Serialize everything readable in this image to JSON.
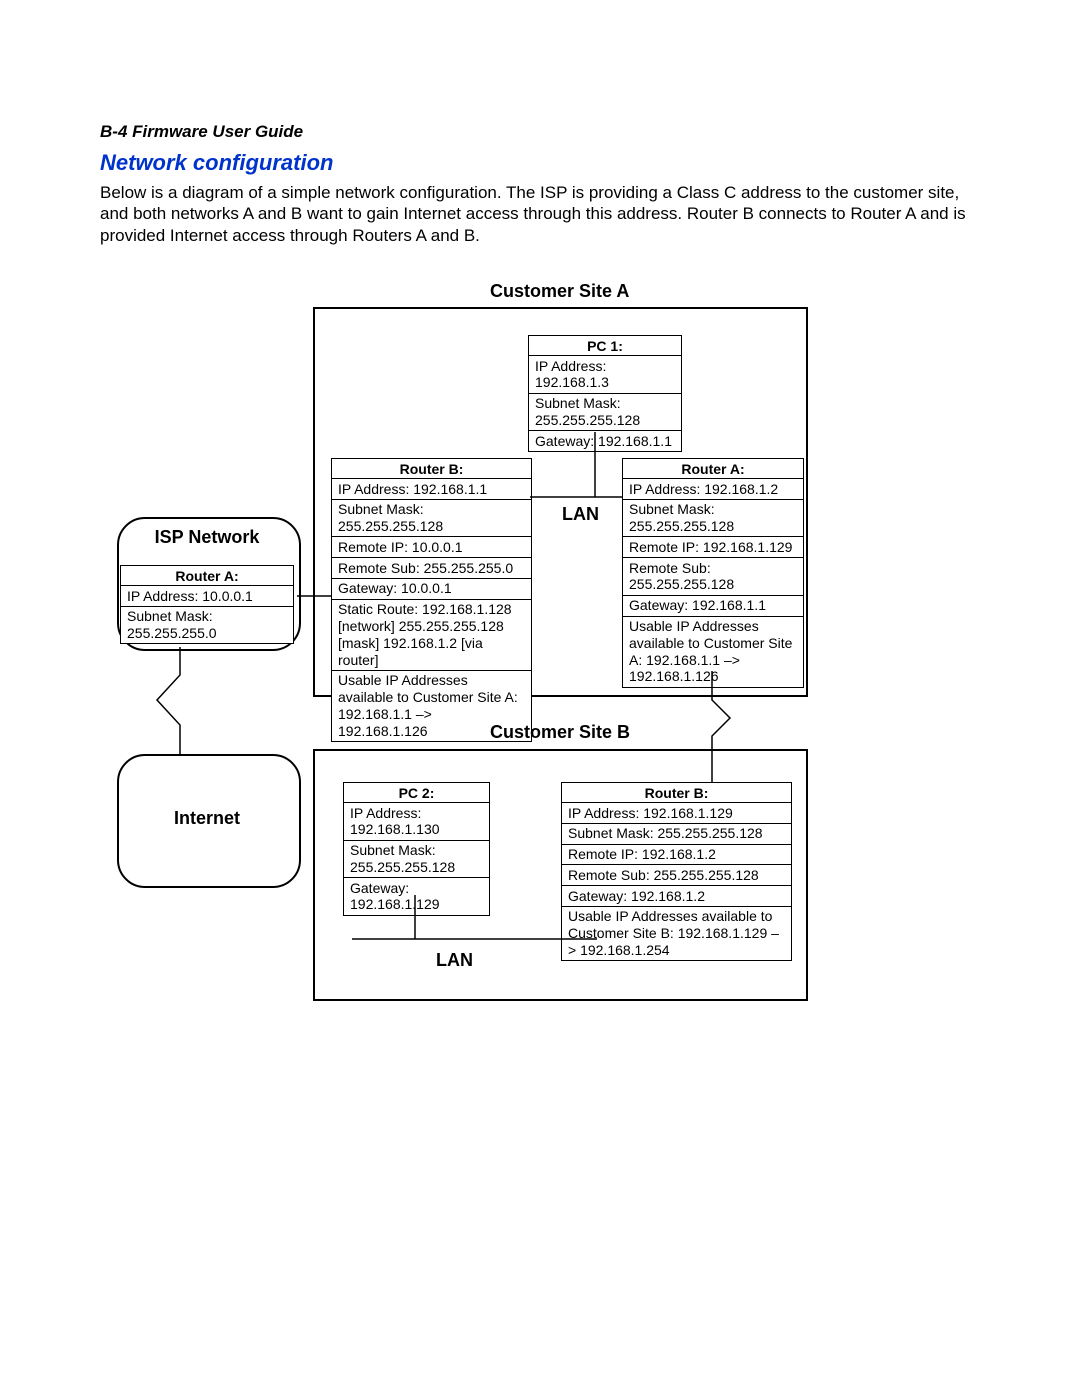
{
  "header": "B-4  Firmware User Guide",
  "title": "Network configuration",
  "body": "Below is a diagram of a simple network configuration. The ISP is providing a Class C address to the customer site, and both networks A and B want to gain Internet access through this address. Router B connects to Router A and is provided Internet access through Routers A and B.",
  "siteA": {
    "title": "Customer Site A",
    "lan": "LAN"
  },
  "siteB": {
    "title": "Customer Site B",
    "lan": "LAN"
  },
  "isp": {
    "title": "ISP Network",
    "routerA": {
      "label": "Router A:",
      "ip": "IP Address: 10.0.0.1",
      "mask": "Subnet Mask: 255.255.255.0"
    }
  },
  "internet": {
    "title": "Internet"
  },
  "pc1": {
    "label": "PC 1:",
    "ip": "IP Address: 192.168.1.3",
    "mask": "Subnet Mask: 255.255.255.128",
    "gw": "Gateway: 192.168.1.1"
  },
  "routerB_A": {
    "label": "Router B:",
    "ip": "IP Address: 192.168.1.1",
    "mask": "Subnet Mask: 255.255.255.128",
    "rip": "Remote IP: 10.0.0.1",
    "rsub": "Remote Sub: 255.255.255.0",
    "gw": "Gateway: 10.0.0.1",
    "static": "Static Route: 192.168.1.128 [network] 255.255.255.128 [mask] 192.168.1.2 [via router]",
    "usable": "Usable IP Addresses available to Customer Site A: 192.168.1.1 –> 192.168.1.126"
  },
  "routerA_A": {
    "label": "Router A:",
    "ip": "IP Address: 192.168.1.2",
    "mask": "Subnet Mask: 255.255.255.128",
    "rip": "Remote IP: 192.168.1.129",
    "rsub": "Remote Sub: 255.255.255.128",
    "gw": "Gateway: 192.168.1.1",
    "usable": "Usable IP Addresses available to Customer Site A: 192.168.1.1 –> 192.168.1.126"
  },
  "pc2": {
    "label": "PC 2:",
    "ip": "IP Address: 192.168.1.130",
    "mask": "Subnet Mask: 255.255.255.128",
    "gw": "Gateway: 192.168.1.129"
  },
  "routerB_B": {
    "label": "Router B:",
    "ip": "IP Address: 192.168.1.129",
    "mask": "Subnet Mask: 255.255.255.128",
    "rip": "Remote IP: 192.168.1.2",
    "rsub": "Remote Sub: 255.255.255.128",
    "gw": "Gateway: 192.168.1.2",
    "usable": "Usable IP Addresses available to Customer Site B: 192.168.1.129 –> 192.168.1.254"
  }
}
